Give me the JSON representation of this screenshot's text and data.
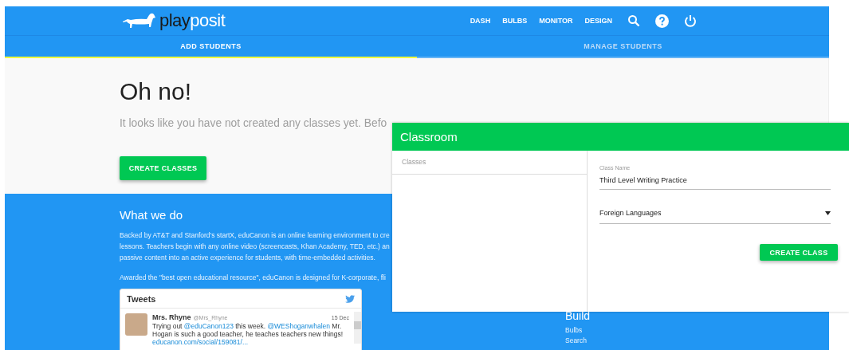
{
  "header": {
    "logo": {
      "dark": "play",
      "light": "posit"
    },
    "nav": [
      "DASH",
      "BULBS",
      "MONITOR",
      "DESIGN"
    ]
  },
  "tabs": [
    {
      "label": "ADD STUDENTS",
      "selected": true
    },
    {
      "label": "MANAGE STUDENTS",
      "selected": false
    }
  ],
  "empty_state": {
    "title": "Oh no!",
    "message": "It looks like you have not created any classes yet. Befo",
    "button": "CREATE CLASSES"
  },
  "about": {
    "title": "What we do",
    "lines": [
      "Backed by AT&T and Stanford's startX, eduCanon is an online learning environment to cre",
      "lessons. Teachers begin with any online video (screencasts, Khan Academy, TED, etc.) an",
      "passive content into an active experience for students, with time-embedded activities."
    ],
    "award": "Awarded the \"best open educational resource\", eduCanon is designed for K-corporate, fli"
  },
  "tweets": {
    "title": "Tweets",
    "items": [
      {
        "name": "Mrs. Rhyne",
        "handle": "@Mrs_Rhyne",
        "date": "15 Dec",
        "text": "Trying out **@eduCanon123** this week. **@WEShoganwhalen** Mr. Hogan is such a good teacher, he teaches teachers new things!",
        "link": "educanon.com/social/159081/..."
      }
    ]
  },
  "footer": {
    "title": "Build",
    "links": [
      "Bulbs",
      "Search"
    ]
  },
  "dialog": {
    "title": "Classroom",
    "classes_header": "Classes",
    "class_name": {
      "label": "Class Name",
      "value": "Third Level Writing Practice"
    },
    "subject": {
      "value": "Foreign Languages"
    },
    "button": "CREATE CLASS"
  }
}
